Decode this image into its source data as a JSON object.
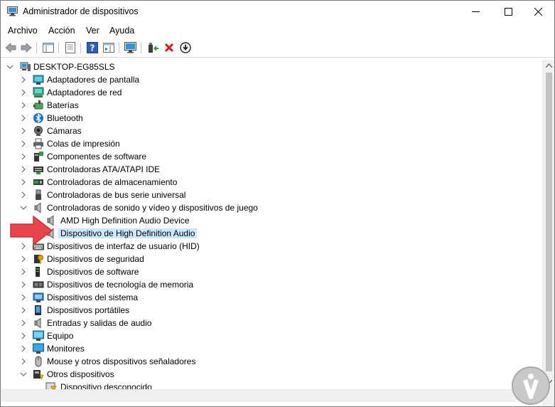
{
  "window": {
    "title": "Administrador de dispositivos"
  },
  "menu": [
    "Archivo",
    "Acción",
    "Ver",
    "Ayuda"
  ],
  "tree": {
    "root": "DESKTOP-EG85SLS",
    "items": [
      {
        "label": "Adaptadores de pantalla",
        "icon": "display-adapter-icon"
      },
      {
        "label": "Adaptadores de red",
        "icon": "network-adapter-icon"
      },
      {
        "label": "Baterías",
        "icon": "battery-icon"
      },
      {
        "label": "Bluetooth",
        "icon": "bluetooth-icon"
      },
      {
        "label": "Cámaras",
        "icon": "camera-icon"
      },
      {
        "label": "Colas de impresión",
        "icon": "printer-icon"
      },
      {
        "label": "Componentes de software",
        "icon": "software-component-icon"
      },
      {
        "label": "Controladoras ATA/ATAPI IDE",
        "icon": "ide-controller-icon"
      },
      {
        "label": "Controladoras de almacenamiento",
        "icon": "storage-controller-icon"
      },
      {
        "label": "Controladoras de bus serie universal",
        "icon": "usb-icon"
      },
      {
        "label": "Controladoras de sonido y vídeo y dispositivos de juego",
        "icon": "speaker-icon",
        "expanded": true,
        "children": [
          {
            "label": "AMD High Definition Audio Device",
            "icon": "speaker-icon"
          },
          {
            "label": "Dispositivo de High Definition Audio",
            "icon": "speaker-icon",
            "selected": true
          }
        ]
      },
      {
        "label": "Dispositivos de interfaz de usuario (HID)",
        "icon": "hid-keyboard-icon"
      },
      {
        "label": "Dispositivos de seguridad",
        "icon": "security-key-icon"
      },
      {
        "label": "Dispositivos de software",
        "icon": "software-device-icon"
      },
      {
        "label": "Dispositivos de tecnología de memoria",
        "icon": "memory-icon"
      },
      {
        "label": "Dispositivos del sistema",
        "icon": "system-device-icon"
      },
      {
        "label": "Dispositivos portátiles",
        "icon": "portable-device-icon"
      },
      {
        "label": "Entradas y salidas de audio",
        "icon": "audio-io-icon"
      },
      {
        "label": "Equipo",
        "icon": "computer-icon"
      },
      {
        "label": "Monitores",
        "icon": "monitor-icon"
      },
      {
        "label": "Mouse y otros dispositivos señaladores",
        "icon": "mouse-icon"
      },
      {
        "label": "Otros dispositivos",
        "icon": "other-devices-icon",
        "expanded": true,
        "children": [
          {
            "label": "Dispositivo desconocido",
            "icon": "unknown-device-icon"
          }
        ]
      }
    ]
  },
  "colors": {
    "selection": "#cce8ff",
    "arrow": "#e8464a",
    "toolbar_delete": "#d21c1c"
  }
}
